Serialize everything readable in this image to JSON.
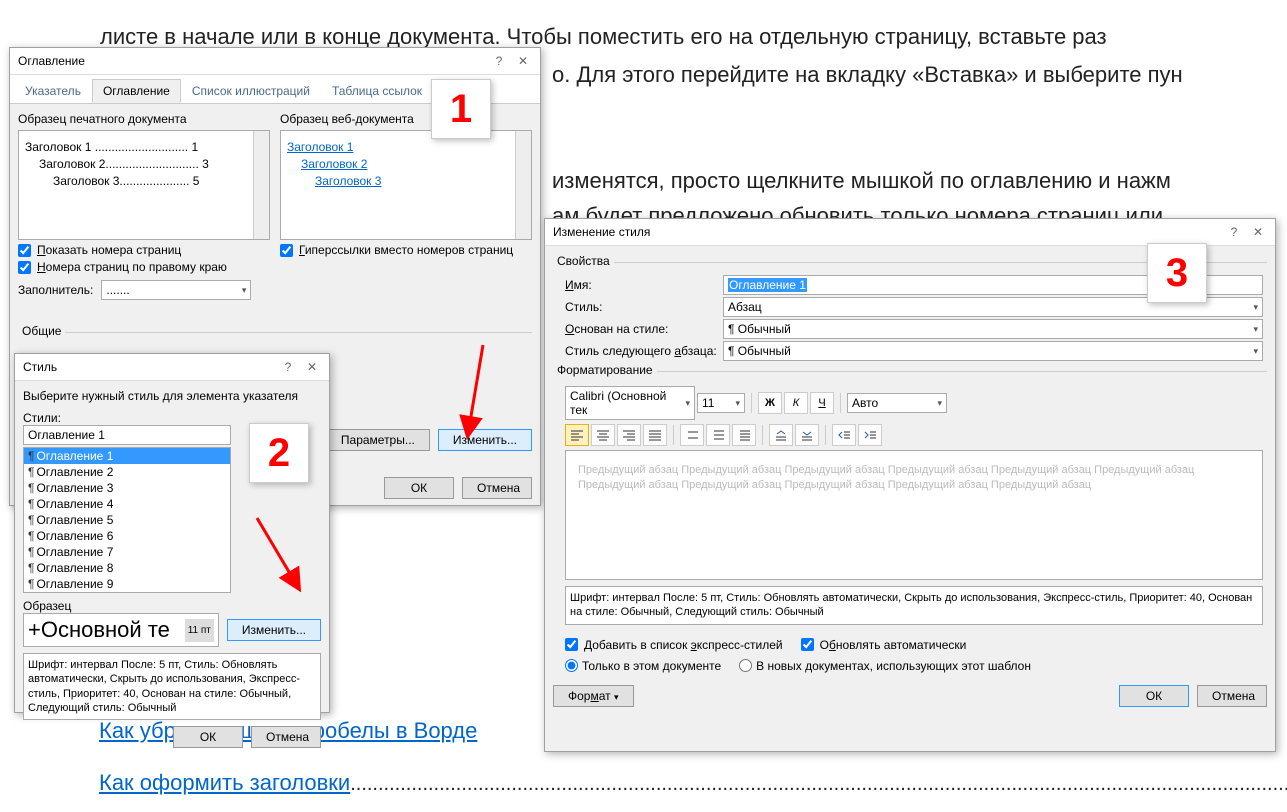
{
  "bg": {
    "line1": "листе в начале или в конце документа. Чтобы поместить его на отдельную страницу, вставьте раз",
    "line2a": "о. Для этого перейдите на вкладку «Вставка» и выберите пун",
    "line3": "изменятся, просто щелкните мышкой по оглавлению и нажм",
    "line4": "ам будет предложено обновить только номера страниц или",
    "line5a": "Как убрать лишние пробелы в Ворде",
    "line6a": "Как оформить заголовки",
    "dots": "................................................................................................................................................................................"
  },
  "badge": {
    "n1": "1",
    "n2": "2",
    "n3": "3"
  },
  "dlg1": {
    "title": "Оглавление",
    "tabs": {
      "t1": "Указатель",
      "t2": "Оглавление",
      "t3": "Список иллюстраций",
      "t4": "Таблица ссылок"
    },
    "printSample": "Образец печатного документа",
    "webSample": "Образец веб-документа",
    "toc1": "Заголовок 1 ............................ 1",
    "toc2": "Заголовок 2............................ 3",
    "toc3": "Заголовок 3..................... 5",
    "link1": "Заголовок 1",
    "link2": "Заголовок 2",
    "link3": "Заголовок 3",
    "showPages": "оказать номера страниц",
    "rightAlign": "омера страниц по правому краю",
    "hyper": "иперссылки вместо номеров страниц",
    "leader": "Заполнитель:",
    "leaderVal": ".......",
    "general": "Общие",
    "params": "Параметры...",
    "modify": "Изменить...",
    "ok": "ОК",
    "cancel": "Отмена"
  },
  "dlg2": {
    "title": "Стиль",
    "help": "Выберите нужный стиль для элемента указателя",
    "stylesLabel": "Стили:",
    "current": "Оглавление 1",
    "items": [
      "Оглавление 1",
      "Оглавление 2",
      "Оглавление 3",
      "Оглавление 4",
      "Оглавление 5",
      "Оглавление 6",
      "Оглавление 7",
      "Оглавление 8",
      "Оглавление 9"
    ],
    "sampleLabel": "Образец",
    "sampleText": "+Основной те",
    "sampleSize": "11 пт",
    "modify": "Изменить...",
    "desc": "Шрифт: интервал После: 5 пт, Стиль: Обновлять автоматически, Скрыть до использования, Экспресс-стиль, Приоритет: 40, Основан на стиле: Обычный, Следующий стиль: Обычный",
    "ok": "ОК",
    "cancel": "Отмена"
  },
  "dlg3": {
    "title": "Изменение стиля",
    "props": "Свойства",
    "name": "Имя:",
    "nameVal": "Оглавление 1",
    "styleLabel": "Стиль:",
    "styleVal": "Абзац",
    "basedOn": "Основан на стиле:",
    "basedOnVal": "¶ Обычный",
    "nextPara": "Стиль следующего абзаца:",
    "nextParaVal": "¶ Обычный",
    "format": "Форматирование",
    "font": "Calibri (Основной тек",
    "size": "11",
    "color": "Авто",
    "previewText": "Предыдущий абзац Предыдущий абзац Предыдущий абзац Предыдущий абзац Предыдущий абзац Предыдущий абзац Предыдущий абзац Предыдущий абзац Предыдущий абзац Предыдущий абзац Предыдущий абзац",
    "desc": "Шрифт: интервал После: 5 пт, Стиль: Обновлять автоматически, Скрыть до использования, Экспресс-стиль, Приоритет: 40, Основан на стиле: Обычный, Следующий стиль: Обычный",
    "addExpress": "Добавить в список экспресс-стилей",
    "autoUpdate": "Обновлять автоматически",
    "onlyDoc": "Только в этом документе",
    "newDocs": "В новых документах, использующих этот шаблон",
    "formatBtn": "Формат",
    "ok": "ОК",
    "cancel": "Отмена"
  }
}
